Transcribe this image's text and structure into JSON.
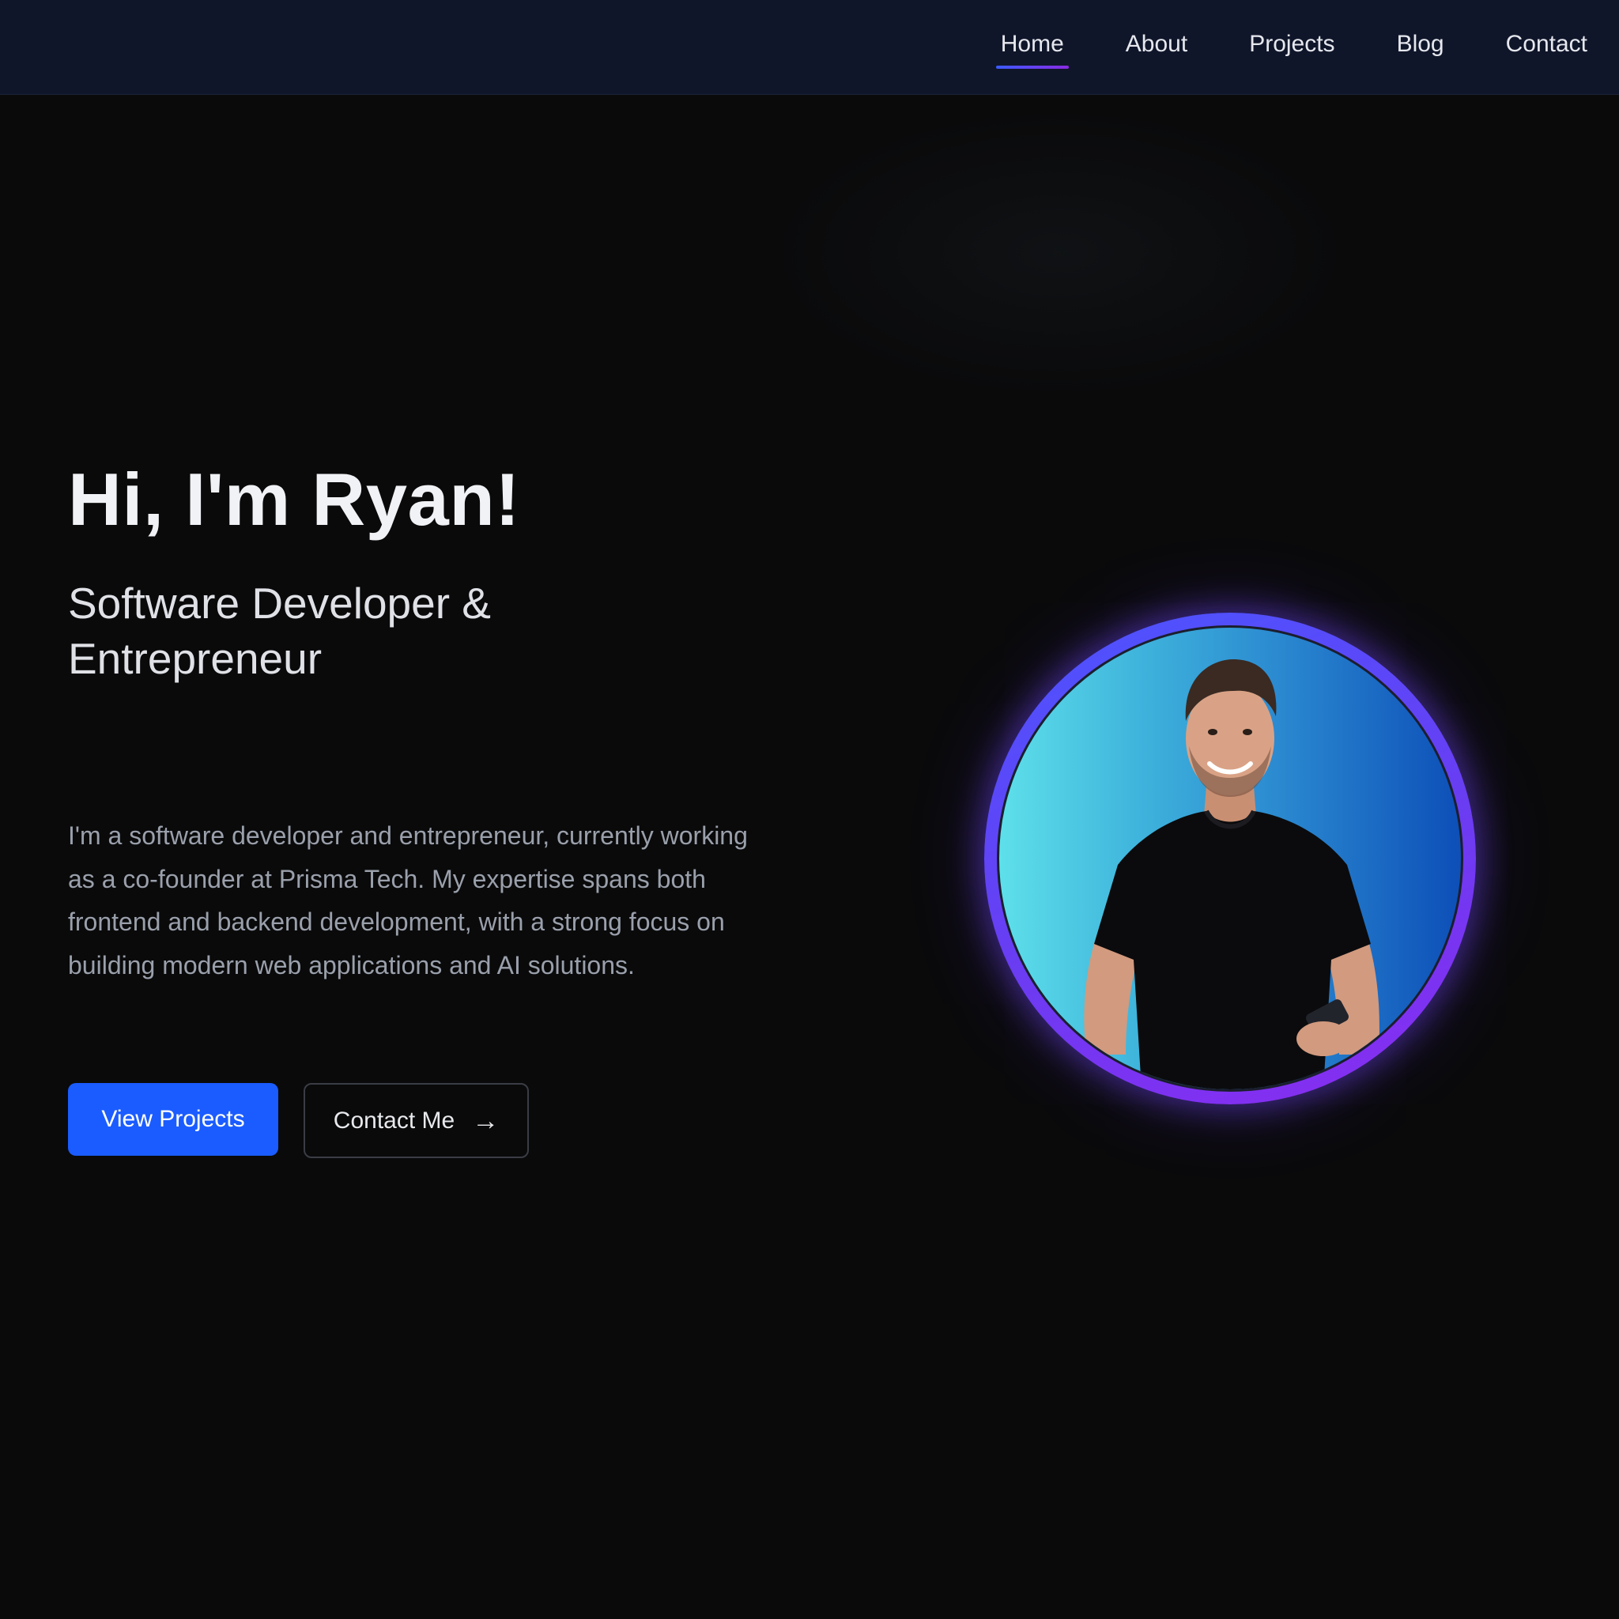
{
  "nav": {
    "items": [
      {
        "label": "Home",
        "active": true
      },
      {
        "label": "About",
        "active": false
      },
      {
        "label": "Projects",
        "active": false
      },
      {
        "label": "Blog",
        "active": false
      },
      {
        "label": "Contact",
        "active": false
      }
    ]
  },
  "hero": {
    "greeting": "Hi, I'm Ryan!",
    "role": "Software Developer & Entrepreneur",
    "bio": "I'm a software developer and entrepreneur, currently working as a co-founder at Prisma Tech. My expertise spans both frontend and backend development, with a strong focus on building modern web applications and AI solutions.",
    "primary_button": "View Projects",
    "secondary_button": "Contact Me",
    "secondary_icon": "→"
  },
  "colors": {
    "nav_background": "#10162a",
    "page_background": "#0a0a0b",
    "primary_button": "#1a5cff",
    "avatar_ring_start": "#4a55ff",
    "avatar_ring_end": "#8b2bf0"
  }
}
